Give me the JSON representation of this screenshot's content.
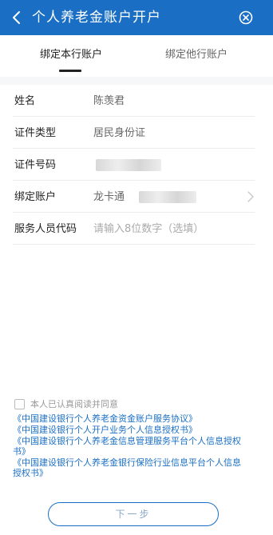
{
  "header": {
    "title": "个人养老金账户开户"
  },
  "tabs": [
    {
      "label": "绑定本行账户",
      "active": true
    },
    {
      "label": "绑定他行账户",
      "active": false
    }
  ],
  "form": {
    "rows": [
      {
        "label": "姓名",
        "value": "陈羡君"
      },
      {
        "label": "证件类型",
        "value": "居民身份证"
      },
      {
        "label": "证件号码",
        "value": ""
      },
      {
        "label": "绑定账户",
        "value": "龙卡通"
      },
      {
        "label": "服务人员代码",
        "placeholder": "请输入8位数字（选填）"
      }
    ]
  },
  "agreement": {
    "checked": false,
    "text": "本人已认真阅读并同意",
    "links": [
      "《中国建设银行个人养老金资金账户服务协议》",
      "《中国建设银行个人开户业务个人信息授权书》",
      "《中国建设银行个人养老金信息管理服务平台个人信息授权书》",
      "《中国建设银行个人养老金银行保险行业信息平台个人信息授权书》"
    ]
  },
  "footer": {
    "next_label": "下一步"
  },
  "colors": {
    "primary": "#1a6fc4",
    "section_bg": "#f6f7f9"
  }
}
